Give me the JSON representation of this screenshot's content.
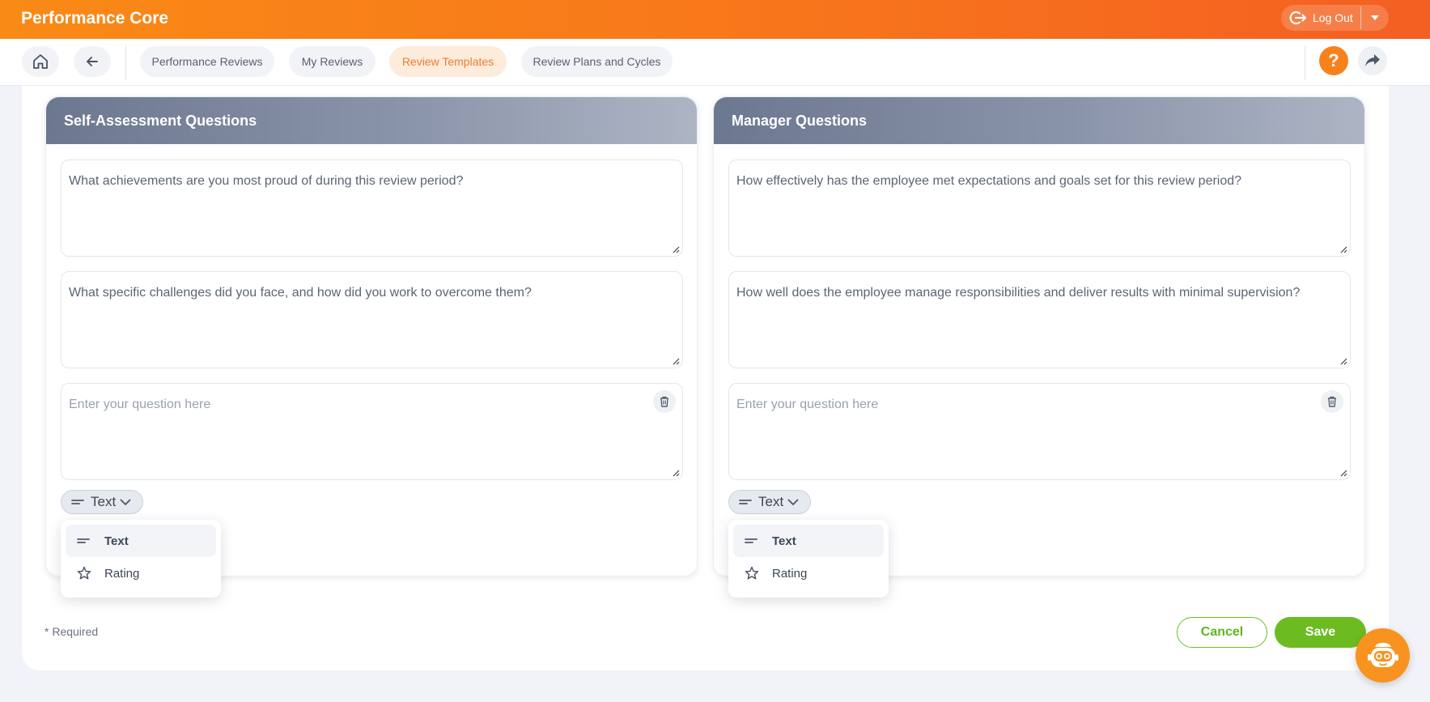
{
  "app": {
    "title": "Performance Core",
    "logout_label": "Log Out"
  },
  "nav": {
    "tabs": [
      {
        "label": "Performance Reviews"
      },
      {
        "label": "My Reviews"
      },
      {
        "label": "Review Templates"
      },
      {
        "label": "Review Plans and Cycles"
      }
    ],
    "help_label": "?"
  },
  "self_assessment": {
    "title": "Self-Assessment Questions",
    "questions": [
      {
        "value": "What achievements are you most proud of during this review period?"
      },
      {
        "value": "What specific challenges did you face, and how did you work to overcome them?"
      },
      {
        "placeholder": "Enter your question here",
        "value": ""
      }
    ],
    "type_selected": "Text",
    "type_options": [
      "Text",
      "Rating"
    ]
  },
  "manager": {
    "title": "Manager Questions",
    "questions": [
      {
        "value": "How effectively has the employee met expectations and goals set for this review period?"
      },
      {
        "value": "How well does the employee manage responsibilities and deliver results with minimal supervision?"
      },
      {
        "placeholder": "Enter your question here",
        "value": ""
      }
    ],
    "type_selected": "Text",
    "type_options": [
      "Text",
      "Rating"
    ]
  },
  "footer": {
    "required_note": "* Required",
    "cancel_label": "Cancel",
    "save_label": "Save"
  },
  "colors": {
    "accent": "#f7811c",
    "success": "#6cbc21",
    "header_slate": "#6c7890"
  }
}
